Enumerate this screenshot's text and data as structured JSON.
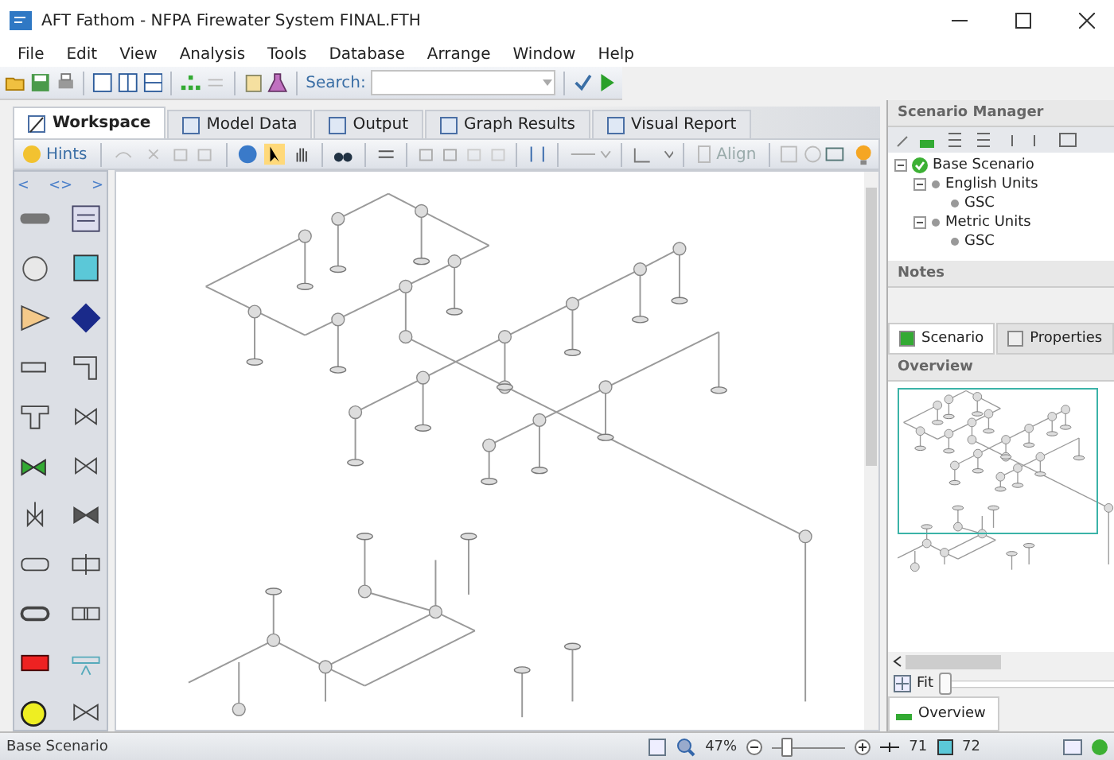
{
  "window": {
    "title": "AFT Fathom - NFPA Firewater System FINAL.FTH"
  },
  "menu": [
    "File",
    "Edit",
    "View",
    "Analysis",
    "Tools",
    "Database",
    "Arrange",
    "Window",
    "Help"
  ],
  "toolbar": {
    "search_label": "Search:"
  },
  "tabs": [
    {
      "label": "Workspace",
      "selected": true
    },
    {
      "label": "Model Data",
      "selected": false
    },
    {
      "label": "Output",
      "selected": false
    },
    {
      "label": "Graph Results",
      "selected": false
    },
    {
      "label": "Visual Report",
      "selected": false
    }
  ],
  "workspace_toolbar": {
    "hints": "Hints",
    "align": "Align"
  },
  "palette": {
    "nav": [
      "<",
      "<>",
      ">"
    ]
  },
  "scenario_manager": {
    "title": "Scenario Manager",
    "tree": [
      {
        "label": "Base Scenario",
        "expanded": true,
        "children": [
          {
            "label": "English Units",
            "expanded": true,
            "children": [
              {
                "label": "GSC"
              }
            ]
          },
          {
            "label": "Metric Units",
            "expanded": true,
            "children": [
              {
                "label": "GSC"
              }
            ]
          }
        ]
      }
    ]
  },
  "notes": {
    "title": "Notes",
    "tabs": [
      {
        "label": "Scenario",
        "selected": true
      },
      {
        "label": "Properties",
        "selected": false
      }
    ]
  },
  "overview": {
    "title": "Overview",
    "fit": "Fit",
    "fit_slider": {
      "level": 0
    },
    "tab": "Overview"
  },
  "status_bar": {
    "scenario": "Base Scenario",
    "zoom": "47%",
    "zoom_slider": {
      "level": 0.15
    },
    "pipes": "71",
    "junctions": "72"
  }
}
